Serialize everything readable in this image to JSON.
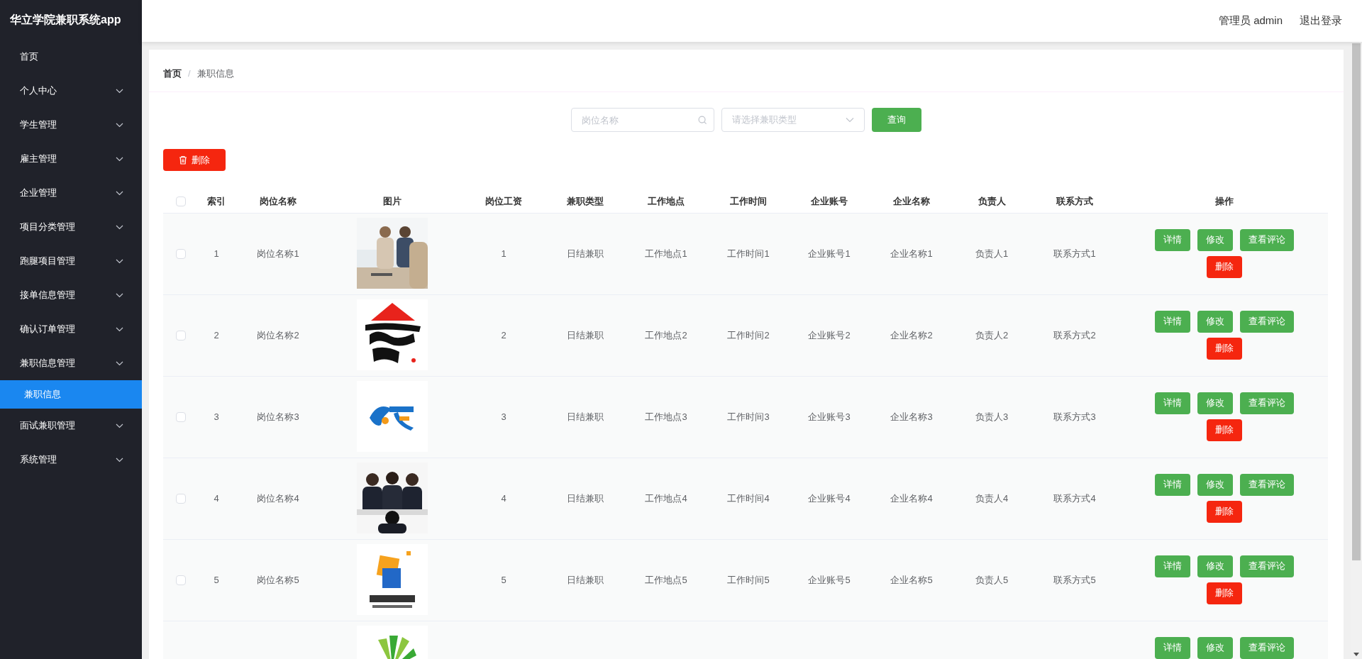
{
  "sidebar": {
    "title": "华立学院兼职系统app",
    "items": [
      {
        "label": "首页",
        "kind": "link"
      },
      {
        "label": "个人中心",
        "kind": "submenu"
      },
      {
        "label": "学生管理",
        "kind": "submenu"
      },
      {
        "label": "雇主管理",
        "kind": "submenu"
      },
      {
        "label": "企业管理",
        "kind": "submenu"
      },
      {
        "label": "项目分类管理",
        "kind": "submenu"
      },
      {
        "label": "跑腿项目管理",
        "kind": "submenu"
      },
      {
        "label": "接单信息管理",
        "kind": "submenu"
      },
      {
        "label": "确认订单管理",
        "kind": "submenu"
      },
      {
        "label": "兼职信息管理",
        "kind": "submenu",
        "children": [
          {
            "label": "兼职信息",
            "selected": true
          }
        ]
      },
      {
        "label": "面试兼职管理",
        "kind": "submenu"
      },
      {
        "label": "系统管理",
        "kind": "submenu"
      }
    ]
  },
  "header": {
    "user": "管理员 admin",
    "logout": "退出登录"
  },
  "breadcrumb": {
    "items": [
      "首页",
      "兼职信息"
    ],
    "separator": "/"
  },
  "search": {
    "name_placeholder": "岗位名称",
    "type_placeholder": "请选择兼职类型",
    "button": "查询"
  },
  "delete_button": "删除",
  "table": {
    "select_all": {
      "checked": false
    },
    "columns": [
      {
        "label": "索引",
        "kind": "text"
      },
      {
        "label": "岗位名称",
        "kind": "text"
      },
      {
        "label": "图片"
      },
      {
        "label": "岗位工资",
        "kind": "text"
      },
      {
        "label": "兼职类型",
        "kind": "text"
      },
      {
        "label": "工作地点",
        "kind": "text"
      },
      {
        "label": "工作时间",
        "kind": "text"
      },
      {
        "label": "企业账号",
        "kind": "text"
      },
      {
        "label": "企业名称",
        "kind": "text"
      },
      {
        "label": "负责人",
        "kind": "text"
      },
      {
        "label": "联系方式",
        "kind": "text"
      },
      {
        "label": "操作",
        "kind": "actions"
      }
    ],
    "rows": [
      {
        "checked": false,
        "cells": [
          "1",
          "岗位名称1",
          "1",
          "日结兼职",
          "工作地点1",
          "工作时间1",
          "企业账号1",
          "企业名称1",
          "负责人1",
          "联系方式1"
        ],
        "image": {
          "kind": "picture"
        },
        "actions": [
          {
            "label": "详情",
            "kind": "primary"
          },
          {
            "label": "修改",
            "kind": "primary"
          },
          {
            "label": "查看评论",
            "kind": "primary"
          },
          {
            "label": "删除",
            "kind": "danger"
          }
        ]
      },
      {
        "checked": false,
        "cells": [
          "2",
          "岗位名称2",
          "2",
          "日结兼职",
          "工作地点2",
          "工作时间2",
          "企业账号2",
          "企业名称2",
          "负责人2",
          "联系方式2"
        ],
        "image": {
          "kind": "picture"
        },
        "actions": [
          {
            "label": "详情",
            "kind": "primary"
          },
          {
            "label": "修改",
            "kind": "primary"
          },
          {
            "label": "查看评论",
            "kind": "primary"
          },
          {
            "label": "删除",
            "kind": "danger"
          }
        ]
      },
      {
        "checked": false,
        "cells": [
          "3",
          "岗位名称3",
          "3",
          "日结兼职",
          "工作地点3",
          "工作时间3",
          "企业账号3",
          "企业名称3",
          "负责人3",
          "联系方式3"
        ],
        "image": {
          "kind": "picture"
        },
        "actions": [
          {
            "label": "详情",
            "kind": "primary"
          },
          {
            "label": "修改",
            "kind": "primary"
          },
          {
            "label": "查看评论",
            "kind": "primary"
          },
          {
            "label": "删除",
            "kind": "danger"
          }
        ]
      },
      {
        "checked": false,
        "cells": [
          "4",
          "岗位名称4",
          "4",
          "日结兼职",
          "工作地点4",
          "工作时间4",
          "企业账号4",
          "企业名称4",
          "负责人4",
          "联系方式4"
        ],
        "image": {
          "kind": "picture"
        },
        "actions": [
          {
            "label": "详情",
            "kind": "primary"
          },
          {
            "label": "修改",
            "kind": "primary"
          },
          {
            "label": "查看评论",
            "kind": "primary"
          },
          {
            "label": "删除",
            "kind": "danger"
          }
        ]
      },
      {
        "checked": false,
        "cells": [
          "5",
          "岗位名称5",
          "5",
          "日结兼职",
          "工作地点5",
          "工作时间5",
          "企业账号5",
          "企业名称5",
          "负责人5",
          "联系方式5"
        ],
        "image": {
          "kind": "picture"
        },
        "actions": [
          {
            "label": "详情",
            "kind": "primary"
          },
          {
            "label": "修改",
            "kind": "primary"
          },
          {
            "label": "查看评论",
            "kind": "primary"
          },
          {
            "label": "删除",
            "kind": "danger"
          }
        ]
      },
      {
        "image": {
          "kind": "picture"
        },
        "actions": [
          {
            "label": "详情",
            "kind": "primary"
          },
          {
            "label": "修改",
            "kind": "primary"
          },
          {
            "label": "查看评论",
            "kind": "primary"
          }
        ]
      }
    ]
  }
}
